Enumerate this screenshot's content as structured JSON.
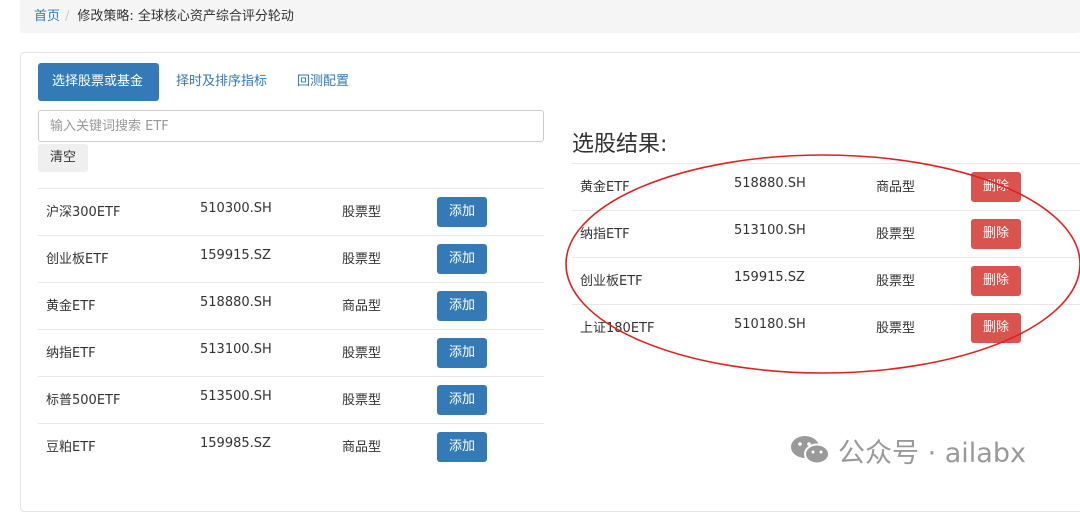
{
  "breadcrumb": {
    "home": "首页",
    "separator": "/",
    "current": "修改策略: 全球核心资产综合评分轮动"
  },
  "tabs": [
    {
      "label": "选择股票或基金",
      "active": true
    },
    {
      "label": "择时及排序指标",
      "active": false
    },
    {
      "label": "回测配置",
      "active": false
    }
  ],
  "search": {
    "placeholder": "输入关键词搜索 ETF",
    "value": ""
  },
  "clear_button": "清空",
  "candidates": {
    "action_label": "添加",
    "rows": [
      {
        "name": "沪深300ETF",
        "code": "510300.SH",
        "type": "股票型"
      },
      {
        "name": "创业板ETF",
        "code": "159915.SZ",
        "type": "股票型"
      },
      {
        "name": "黄金ETF",
        "code": "518880.SH",
        "type": "商品型"
      },
      {
        "name": "纳指ETF",
        "code": "513100.SH",
        "type": "股票型"
      },
      {
        "name": "标普500ETF",
        "code": "513500.SH",
        "type": "股票型"
      },
      {
        "name": "豆粕ETF",
        "code": "159985.SZ",
        "type": "商品型"
      }
    ]
  },
  "results": {
    "title": "选股结果:",
    "action_label": "删除",
    "rows": [
      {
        "name": "黄金ETF",
        "code": "518880.SH",
        "type": "商品型"
      },
      {
        "name": "纳指ETF",
        "code": "513100.SH",
        "type": "股票型"
      },
      {
        "name": "创业板ETF",
        "code": "159915.SZ",
        "type": "股票型"
      },
      {
        "name": "上证180ETF",
        "code": "510180.SH",
        "type": "股票型"
      }
    ]
  },
  "watermark": {
    "text": "公众号 · ailabx",
    "icon": "wechat-icon"
  },
  "colors": {
    "primary": "#337ab7",
    "danger": "#d9534f",
    "annotation": "#e02020",
    "watermark": "#9a9a9a"
  }
}
